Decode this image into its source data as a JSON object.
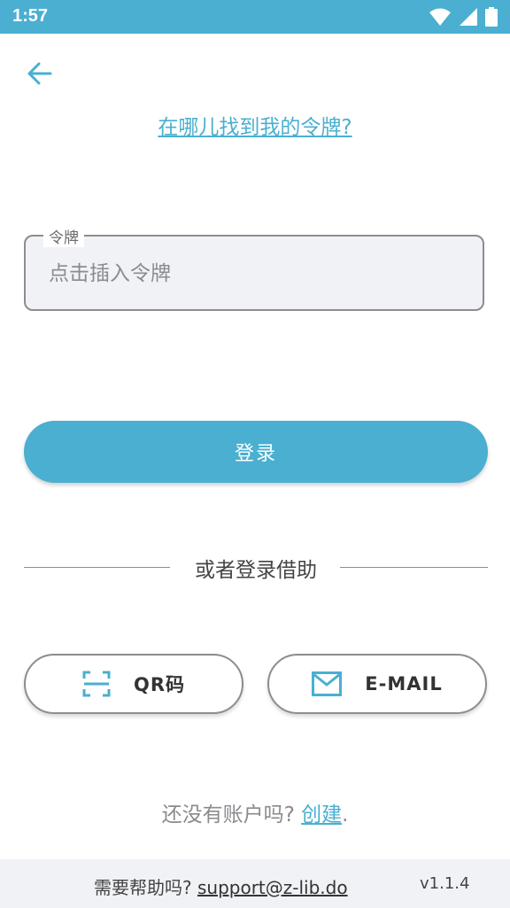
{
  "status_bar": {
    "time": "1:57",
    "icons": [
      "wifi-icon",
      "signal-icon",
      "battery-icon"
    ]
  },
  "header": {
    "back_icon": "arrow-left-icon",
    "where_link": "在哪儿找到我的令牌?"
  },
  "token": {
    "label": "令牌",
    "placeholder": "点击插入令牌",
    "value": ""
  },
  "login_button": "登录",
  "divider_text": "或者登录借助",
  "alt_login": {
    "qr": {
      "icon": "qr-scan-icon",
      "label": "QR码"
    },
    "email": {
      "icon": "mail-icon",
      "label": "E-MAIL"
    }
  },
  "signup": {
    "prompt": "还没有账户吗? ",
    "link": "创建",
    "suffix": "."
  },
  "footer": {
    "help_prompt": "需要帮助吗? ",
    "email": "support@z-lib.do",
    "version": "v1.1.4"
  },
  "colors": {
    "accent": "#4aafd0",
    "border": "#8c8c92",
    "field_bg": "#f1f2f6"
  }
}
